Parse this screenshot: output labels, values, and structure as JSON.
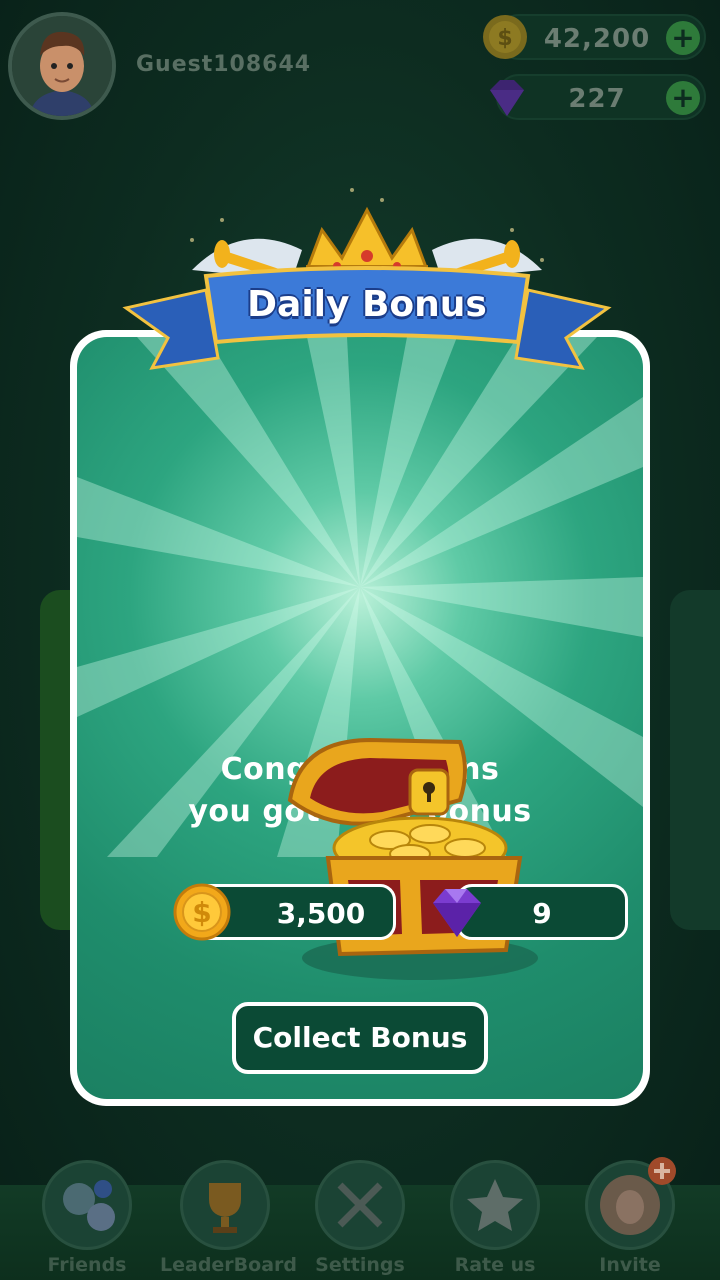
{
  "header": {
    "username": "Guest108644",
    "coins": "42,200",
    "gems": "227",
    "add_symbol": "+"
  },
  "modal": {
    "title": "Daily Bonus",
    "message_line1": "Congratulations",
    "message_line2": "you got daily bonus",
    "reward_coins": "3,500",
    "reward_gems": "9",
    "collect_label": "Collect Bonus"
  },
  "bottom_nav": {
    "items": [
      {
        "label": "Friends",
        "icon": "friends-icon"
      },
      {
        "label": "LeaderBoard",
        "icon": "trophy-icon"
      },
      {
        "label": "Settings",
        "icon": "tools-icon"
      },
      {
        "label": "Rate us",
        "icon": "star-icon"
      },
      {
        "label": "Invite",
        "icon": "invite-icon"
      }
    ]
  },
  "colors": {
    "accent": "#1f8d6c",
    "dark_panel": "#0b4a35",
    "banner_blue": "#2f6fd0",
    "gold": "#f5b419",
    "gem_purple": "#7b3cd0"
  }
}
